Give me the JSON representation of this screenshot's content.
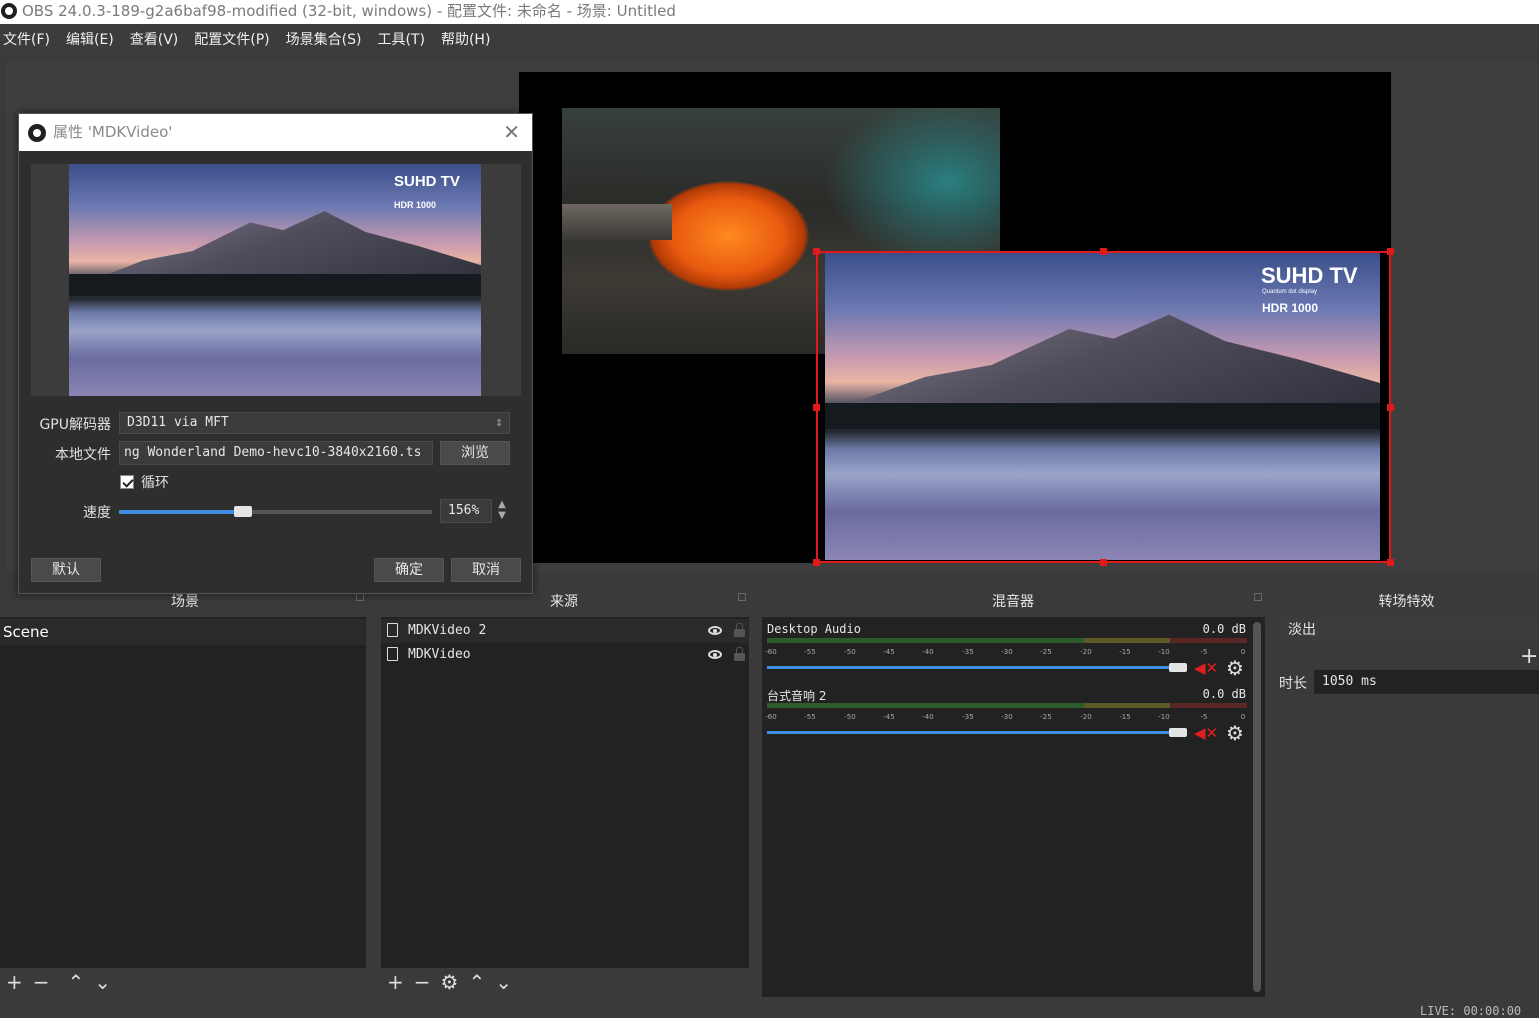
{
  "window": {
    "title": "OBS 24.0.3-189-g2a6baf98-modified (32-bit, windows) - 配置文件: 未命名 - 场景: Untitled"
  },
  "menu": [
    "文件(F)",
    "编辑(E)",
    "查看(V)",
    "配置文件(P)",
    "场景集合(S)",
    "工具(T)",
    "帮助(H)"
  ],
  "preview": {
    "brand_title": "SUHD TV",
    "brand_sub": "Quantum dot display",
    "brand_hdr": "HDR 1000"
  },
  "dialog": {
    "title": "属性 'MDKVideo'",
    "gpu_label": "GPU解码器",
    "gpu_value": "D3D11 via MFT",
    "file_label": "本地文件",
    "file_value": "ng Wonderland Demo-hevc10-3840x2160.ts",
    "browse_label": "浏览",
    "loop_label": "循环",
    "loop_checked": true,
    "speed_label": "速度",
    "speed_value": "156%",
    "speed_fraction": 0.39,
    "default_label": "默认",
    "ok_label": "确定",
    "cancel_label": "取消"
  },
  "docks": {
    "scenes": {
      "title": "场景",
      "items": [
        "Scene"
      ]
    },
    "sources": {
      "title": "来源",
      "items": [
        "MDKVideo 2",
        "MDKVideo"
      ]
    },
    "mixer": {
      "title": "混音器",
      "tick_labels": [
        "-60",
        "-55",
        "-50",
        "-45",
        "-40",
        "-35",
        "-30",
        "-25",
        "-20",
        "-15",
        "-10",
        "-5",
        "0"
      ],
      "channels": [
        {
          "name": "Desktop Audio",
          "db": "0.0 dB",
          "volume": 1.0
        },
        {
          "name": "台式音响 2",
          "db": "0.0 dB",
          "volume": 1.0
        }
      ]
    },
    "transitions": {
      "title": "转场特效",
      "selected": "淡出",
      "duration_label": "时长",
      "duration_value": "1050 ms"
    }
  },
  "status": {
    "live": "LIVE: 00:00:00"
  },
  "colors": {
    "selection": "#e01a1a",
    "accent": "#3d8ee0"
  }
}
